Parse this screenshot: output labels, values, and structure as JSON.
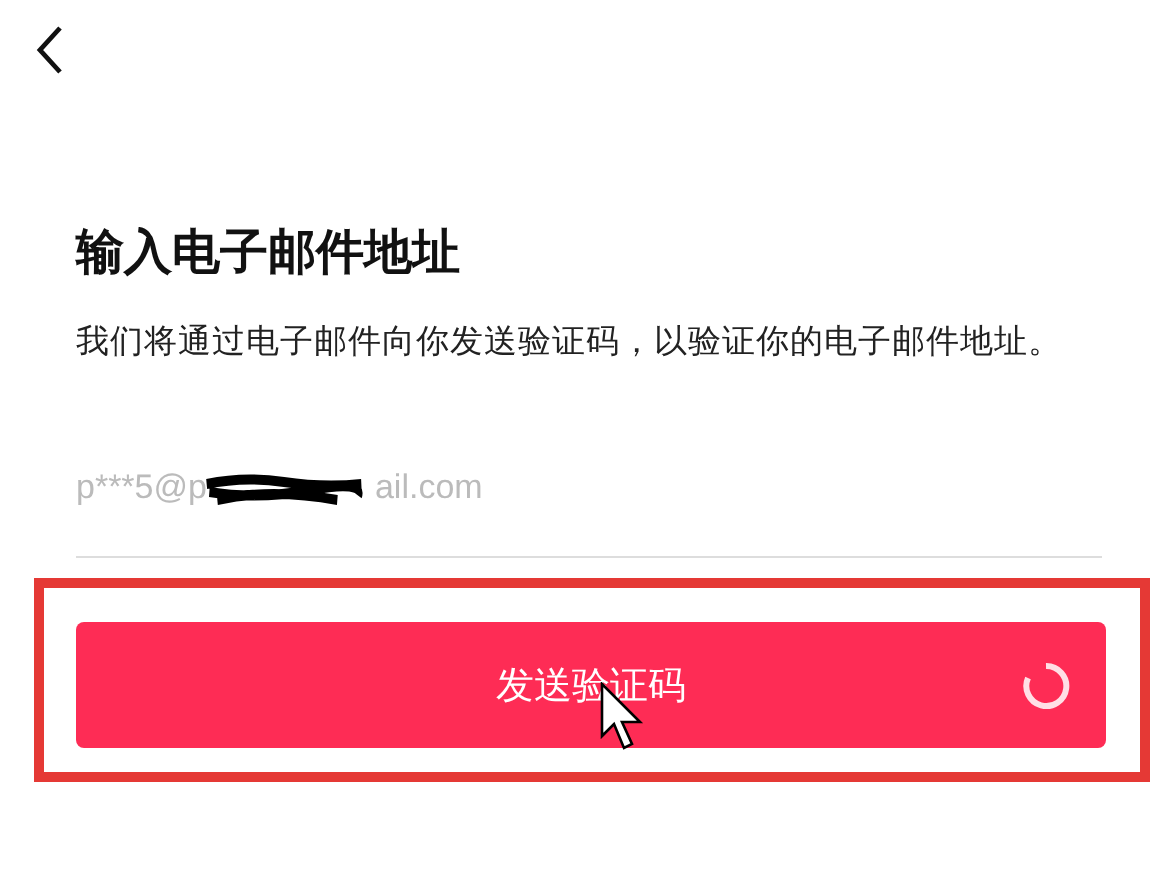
{
  "header": {
    "back": true
  },
  "title": "输入电子邮件地址",
  "description": "我们将通过电子邮件向你发送验证码，以验证你的电子邮件地址。",
  "email_field": {
    "value_start": "p***5@p",
    "value_end": "ail.com",
    "redacted": true
  },
  "send_button": {
    "label": "发送验证码",
    "loading": true,
    "highlighted": true
  }
}
